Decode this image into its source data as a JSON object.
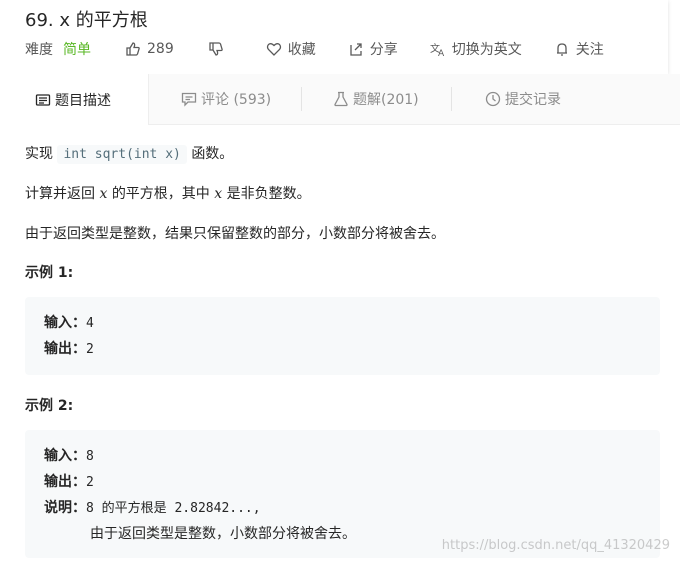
{
  "problem": {
    "title": "69. x 的平方根",
    "difficulty_label": "难度",
    "difficulty_value": "简单",
    "likes": "289",
    "favorite_label": "收藏",
    "share_label": "分享",
    "translate_label": "切换为英文",
    "follow_label": "关注"
  },
  "tabs": [
    {
      "label": "题目描述",
      "icon": "description-icon"
    },
    {
      "label": "评论 (593)",
      "icon": "comment-icon"
    },
    {
      "label": "题解(201)",
      "icon": "flask-icon"
    },
    {
      "label": "提交记录",
      "icon": "clock-icon"
    }
  ],
  "description": {
    "p1_pre": "实现",
    "p1_code": "int sqrt(int x)",
    "p1_post": "函数。",
    "p2_pre": "计算并返回",
    "p2_var": "x",
    "p2_mid": "的平方根，其中",
    "p2_var2": "x",
    "p2_post": "是非负整数。",
    "p3": "由于返回类型是整数，结果只保留整数的部分，小数部分将被舍去。"
  },
  "examples": [
    {
      "heading": "示例 1:",
      "input_label": "输入：",
      "input": "4",
      "output_label": "输出：",
      "output": "2"
    },
    {
      "heading": "示例 2:",
      "input_label": "输入：",
      "input": "8",
      "output_label": "输出：",
      "output": "2",
      "explain_label": "说明：",
      "explain_line1": "8 的平方根是 2.82842...,",
      "explain_line2": "由于返回类型是整数，小数部分将被舍去。"
    }
  ],
  "watermark": "https://blog.csdn.net/qq_41320429",
  "colors": {
    "easy": "#5ab726",
    "code_bg": "#f7f9fa"
  }
}
